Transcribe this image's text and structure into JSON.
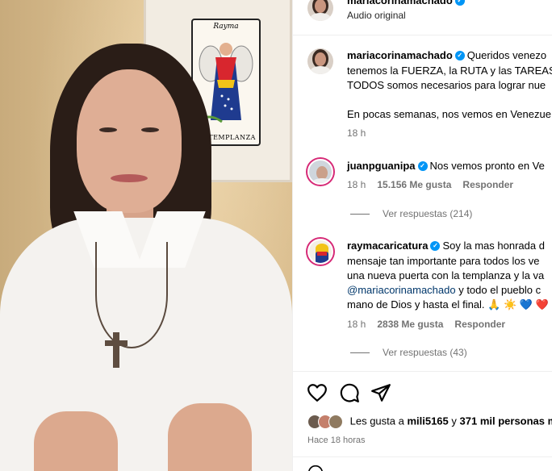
{
  "header": {
    "username": "mariacorinamachado",
    "subtitle": "Audio original"
  },
  "poster": {
    "signature": "Rayma",
    "card_title": "LA TEMPLANZA"
  },
  "caption": {
    "username": "mariacorinamachado",
    "line1": "Queridos venezo",
    "line2": "tenemos la FUERZA, la RUTA y las TAREAS",
    "line3": "TODOS somos necesarios para lograr nue",
    "line4": "En pocas semanas, nos vemos en Venezue",
    "time": "18 h"
  },
  "comments": [
    {
      "username": "juanpguanipa",
      "line1": "Nos vemos pronto en Ve",
      "time": "18 h",
      "likes": "15.156 Me gusta",
      "reply_label": "Responder",
      "view_replies": "Ver respuestas (214)"
    },
    {
      "username": "raymacaricatura",
      "line1": "Soy la mas honrada d",
      "line2": "mensaje tan importante para todos los ve",
      "line3": "una nueva puerta con la templanza y la va",
      "mention": "@mariacorinamachado",
      "line4_rest": " y todo el pueblo c",
      "line5": "mano de Dios y hasta el final. 🙏 ☀️ 💙 ❤️",
      "time": "18 h",
      "likes": "2838 Me gusta",
      "reply_label": "Responder",
      "view_replies": "Ver respuestas (43)"
    }
  ],
  "actions": {
    "like_icon": "heart-icon",
    "comment_icon": "comment-icon",
    "share_icon": "send-icon"
  },
  "likes_summary": {
    "prefix": "Les gusta a ",
    "user": "mili5165",
    "middle": " y ",
    "count": "371 mil personas m"
  },
  "time_ago": "Hace 18 horas",
  "colors": {
    "verified": "#0095f6",
    "mention": "#00376b",
    "muted": "#737373",
    "story_ring": "#d62976"
  }
}
